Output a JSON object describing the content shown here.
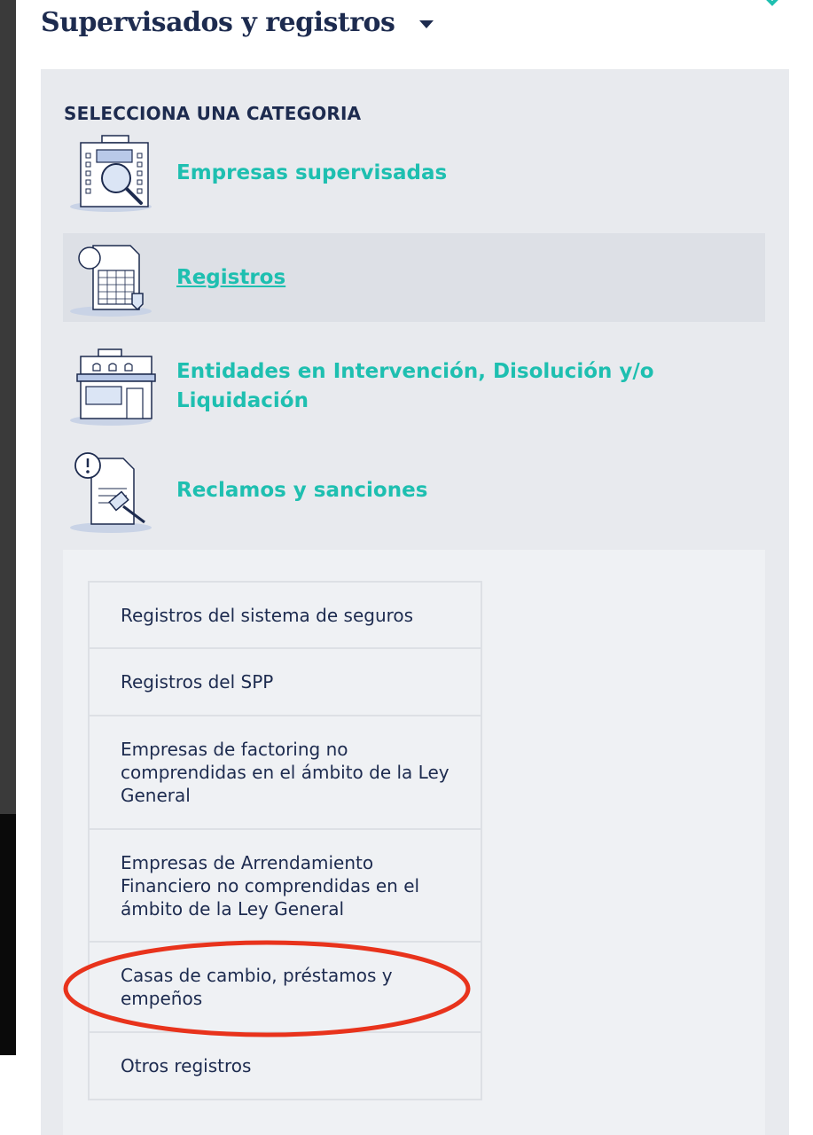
{
  "header": {
    "title": "Supervisados y registros"
  },
  "panel": {
    "heading": "SELECCIONA UNA CATEGORIA",
    "categories": [
      {
        "label": "Empresas supervisadas",
        "icon": "building-search-icon",
        "active": false
      },
      {
        "label": "Registros",
        "icon": "registry-document-icon",
        "active": true
      },
      {
        "label": "Entidades en Intervención, Disolución y/o Liquidación",
        "icon": "closed-store-icon",
        "active": false
      },
      {
        "label": "Reclamos y sanciones",
        "icon": "complaint-gavel-icon",
        "active": false
      }
    ],
    "subitems": [
      "Registros del sistema de seguros",
      "Registros del SPP",
      "Empresas de factoring no comprendidas en el ámbito de la Ley General",
      "Empresas de Arrendamiento Financiero no comprendidas en el ámbito de la Ley General",
      "Casas de cambio, préstamos y empeños",
      "Otros registros"
    ]
  },
  "colors": {
    "navy": "#1d2b4f",
    "teal": "#1ebfb0",
    "panel": "#e8eaee",
    "annotation_red": "#e8331c"
  }
}
